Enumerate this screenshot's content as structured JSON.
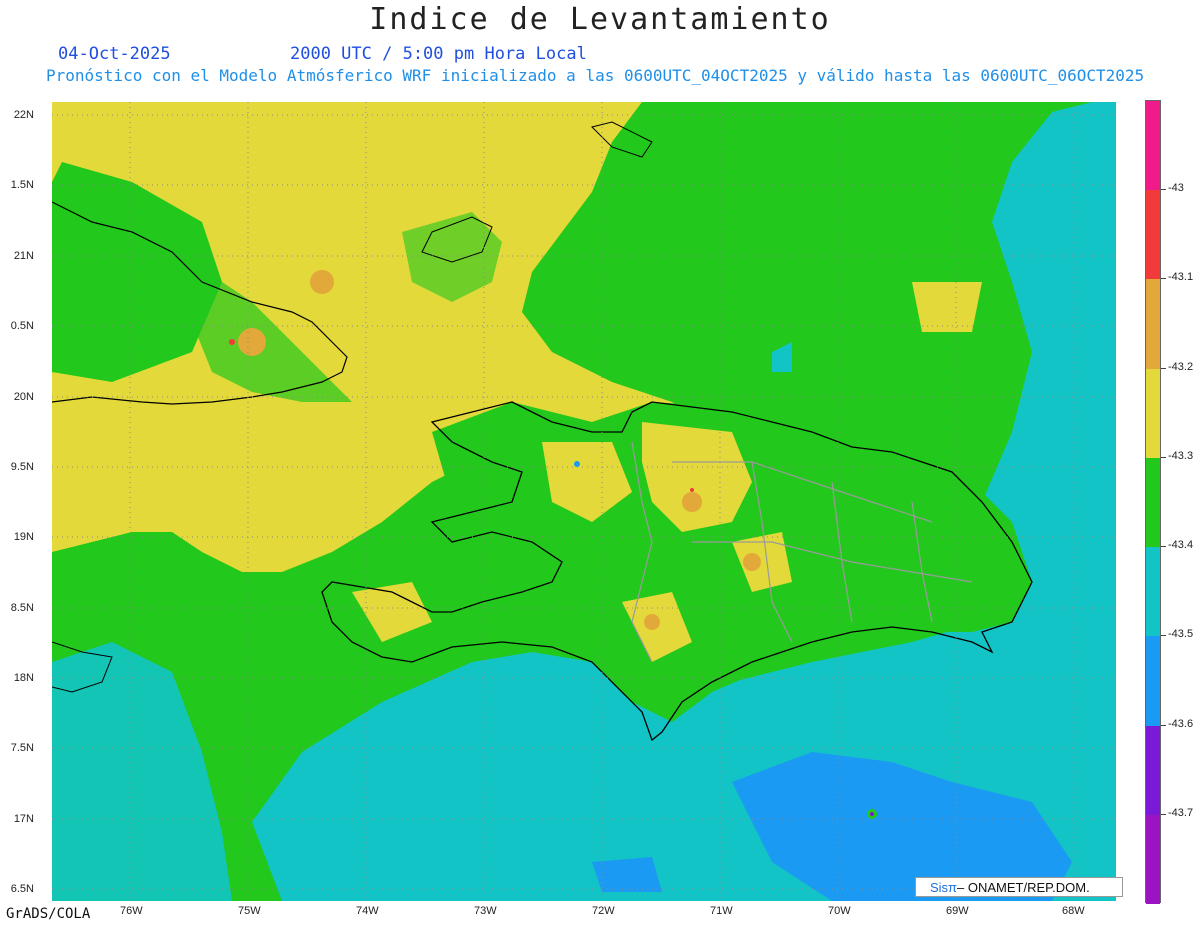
{
  "header": {
    "title": "Indice de Levantamiento",
    "date": "04-Oct-2025",
    "time": "2000 UTC / 5:00 pm Hora Local",
    "description": "Pronóstico con el Modelo Atmósferico WRF inicializado a las 0600UTC_04OCT2025 y válido hasta las  0600UTC_06OCT2025"
  },
  "axes": {
    "y_ticks": [
      "22N",
      "1.5N",
      "21N",
      "0.5N",
      "20N",
      "9.5N",
      "19N",
      "8.5N",
      "18N",
      "7.5N",
      "17N",
      "6.5N"
    ],
    "x_ticks": [
      "76W",
      "75W",
      "74W",
      "73W",
      "72W",
      "71W",
      "70W",
      "69W",
      "68W"
    ]
  },
  "colorbar": {
    "colors": [
      "#f01a8a",
      "#f23a3a",
      "#e3a83a",
      "#e3d93a",
      "#22c81c",
      "#12c4c6",
      "#1a9af2",
      "#7a1ad8",
      "#9a14c4"
    ],
    "labels": [
      "-43",
      "-43.1",
      "-43.2",
      "-43.3",
      "-43.4",
      "-43.5",
      "-43.6",
      "-43.7"
    ]
  },
  "footer": {
    "credit": "GrADS/COLA",
    "logo_brand": "Sisπ",
    "logo_org": " – ONAMET/REP.DOM."
  }
}
